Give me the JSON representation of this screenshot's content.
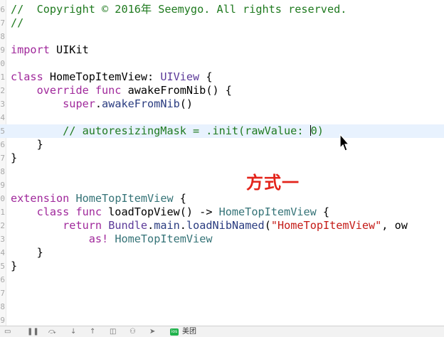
{
  "editor": {
    "lines": [
      {
        "ln": "6",
        "parts": [
          {
            "cls": "c",
            "text": "//  Copyright © 2016年 Seemygo. All rights reserved."
          }
        ]
      },
      {
        "ln": "7",
        "parts": [
          {
            "cls": "c",
            "text": "//"
          }
        ]
      },
      {
        "ln": "8",
        "parts": []
      },
      {
        "ln": "9",
        "parts": [
          {
            "cls": "k",
            "text": "import"
          },
          {
            "cls": "d",
            "text": " UIKit"
          }
        ]
      },
      {
        "ln": "0",
        "parts": []
      },
      {
        "ln": "1",
        "parts": [
          {
            "cls": "k",
            "text": "class"
          },
          {
            "cls": "d",
            "text": " HomeTopItemView: "
          },
          {
            "cls": "t",
            "text": "UIView"
          },
          {
            "cls": "d",
            "text": " {"
          }
        ]
      },
      {
        "ln": "2",
        "parts": [
          {
            "cls": "d",
            "text": "    "
          },
          {
            "cls": "k",
            "text": "override func"
          },
          {
            "cls": "d",
            "text": " awakeFromNib() {"
          }
        ]
      },
      {
        "ln": "3",
        "parts": [
          {
            "cls": "d",
            "text": "        "
          },
          {
            "cls": "k",
            "text": "super"
          },
          {
            "cls": "d",
            "text": "."
          },
          {
            "cls": "m",
            "text": "awakeFromNib"
          },
          {
            "cls": "d",
            "text": "()"
          }
        ]
      },
      {
        "ln": "4",
        "parts": []
      },
      {
        "ln": "5",
        "active": true,
        "parts": [
          {
            "cls": "c",
            "text": "        // autoresizingMask = .init(rawValue: "
          },
          {
            "cls": "caret",
            "text": ""
          },
          {
            "cls": "c",
            "text": "0)"
          }
        ]
      },
      {
        "ln": "6",
        "parts": [
          {
            "cls": "d",
            "text": "    }"
          }
        ]
      },
      {
        "ln": "7",
        "parts": [
          {
            "cls": "d",
            "text": "}"
          }
        ]
      },
      {
        "ln": "8",
        "parts": []
      },
      {
        "ln": "9",
        "parts": []
      },
      {
        "ln": "0",
        "parts": [
          {
            "cls": "k",
            "text": "extension"
          },
          {
            "cls": "d",
            "text": " "
          },
          {
            "cls": "p",
            "text": "HomeTopItemView"
          },
          {
            "cls": "d",
            "text": " {"
          }
        ]
      },
      {
        "ln": "1",
        "parts": [
          {
            "cls": "d",
            "text": "    "
          },
          {
            "cls": "k",
            "text": "class func"
          },
          {
            "cls": "d",
            "text": " loadTopView() -> "
          },
          {
            "cls": "p",
            "text": "HomeTopItemView"
          },
          {
            "cls": "d",
            "text": " {"
          }
        ]
      },
      {
        "ln": "2",
        "parts": [
          {
            "cls": "d",
            "text": "        "
          },
          {
            "cls": "k",
            "text": "return"
          },
          {
            "cls": "d",
            "text": " "
          },
          {
            "cls": "t",
            "text": "Bundle"
          },
          {
            "cls": "d",
            "text": "."
          },
          {
            "cls": "m",
            "text": "main"
          },
          {
            "cls": "d",
            "text": "."
          },
          {
            "cls": "m",
            "text": "loadNibNamed"
          },
          {
            "cls": "d",
            "text": "("
          },
          {
            "cls": "s",
            "text": "\"HomeTopItemView\""
          },
          {
            "cls": "d",
            "text": ", ow"
          }
        ]
      },
      {
        "ln": "3",
        "parts": [
          {
            "cls": "d",
            "text": "            "
          },
          {
            "cls": "k",
            "text": "as!"
          },
          {
            "cls": "d",
            "text": " "
          },
          {
            "cls": "p",
            "text": "HomeTopItemView"
          }
        ]
      },
      {
        "ln": "4",
        "parts": [
          {
            "cls": "d",
            "text": "    }"
          }
        ]
      },
      {
        "ln": "5",
        "parts": [
          {
            "cls": "d",
            "text": "}"
          }
        ]
      },
      {
        "ln": "6",
        "parts": []
      },
      {
        "ln": "7",
        "parts": []
      },
      {
        "ln": "8",
        "parts": []
      },
      {
        "ln": "9",
        "parts": []
      }
    ]
  },
  "annotation": {
    "text": "方式一",
    "color": "#e3231a"
  },
  "colors": {
    "comment": "#1f7a1f",
    "keyword": "#a0289b",
    "system_type": "#5c3a99",
    "project_type": "#357377",
    "active_line": "#e8f2fe"
  },
  "toolbar": {
    "icons": [
      "panel-toggle-icon",
      "pause-icon",
      "step-over-icon",
      "step-into-icon",
      "step-out-icon",
      "view-hierarchy-icon",
      "memory-graph-icon",
      "location-icon"
    ],
    "badge_text": "ios",
    "label": "美团"
  }
}
